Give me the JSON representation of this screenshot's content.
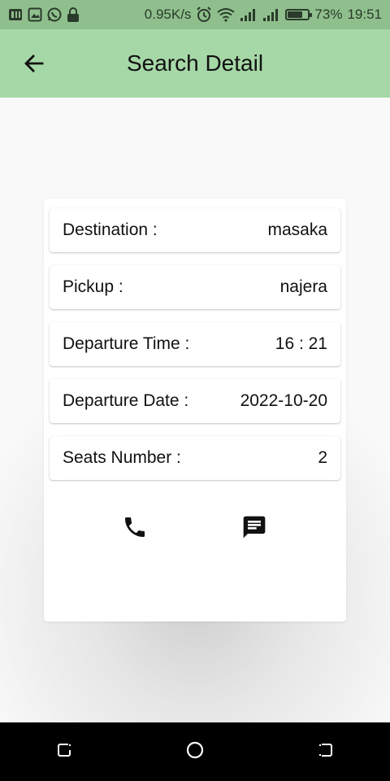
{
  "status_bar": {
    "network_speed": "0.95K/s",
    "battery_percent": "73%",
    "battery_level": 0.73,
    "time": "19:51"
  },
  "app_bar": {
    "title": "Search Detail"
  },
  "details": [
    {
      "label": "Destination :",
      "value": "masaka"
    },
    {
      "label": "Pickup :",
      "value": "najera"
    },
    {
      "label": "Departure Time :",
      "value": "16 : 21"
    },
    {
      "label": "Departure Date :",
      "value": "2022-10-20"
    },
    {
      "label": "Seats Number :",
      "value": "2"
    }
  ],
  "colors": {
    "status_bar_bg": "#8fbf8c",
    "app_bar_bg": "#a6d7a6",
    "nav_bar_bg": "#000000"
  },
  "icons": {
    "back": "arrow-back-icon",
    "call": "phone-icon",
    "message": "message-icon"
  }
}
